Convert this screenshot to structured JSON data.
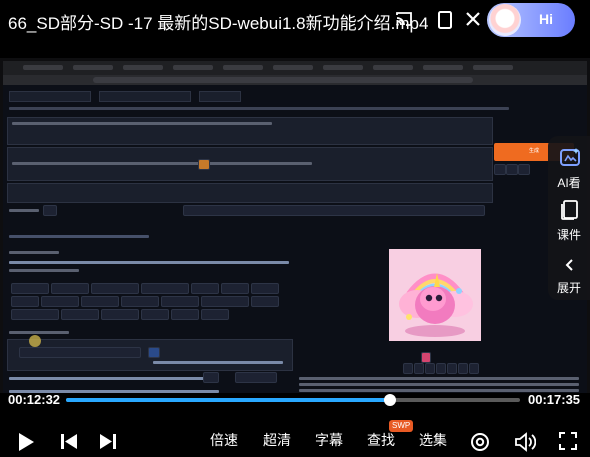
{
  "header": {
    "title": "66_SD部分-SD -17 最新的SD-webui1.8新功能介绍.mp4",
    "assistant_label": "Hi"
  },
  "side_panel": {
    "ai_label": "AI看",
    "course_label": "课件",
    "expand_label": "展开"
  },
  "player": {
    "current_time": "00:12:32",
    "total_time": "00:17:35",
    "progress": 0.713,
    "accent_color": "#29a8ff",
    "speed_label": "倍速",
    "quality_label": "超清",
    "subtitle_label": "字幕",
    "search_label": "查找",
    "search_badge": "SWP",
    "episodes_label": "选集"
  },
  "icons": {
    "cast": "cast-icon",
    "rotate": "rotate-screen-icon",
    "close": "close-icon",
    "play": "play-icon",
    "prev": "previous-icon",
    "next": "next-icon",
    "danmaku": "danmaku-icon",
    "volume": "volume-icon",
    "fullscreen": "fullscreen-icon",
    "ai": "ai-view-icon",
    "courseware": "courseware-icon",
    "expand": "chevron-left-icon"
  },
  "webui": {
    "generate_label": "生成"
  }
}
